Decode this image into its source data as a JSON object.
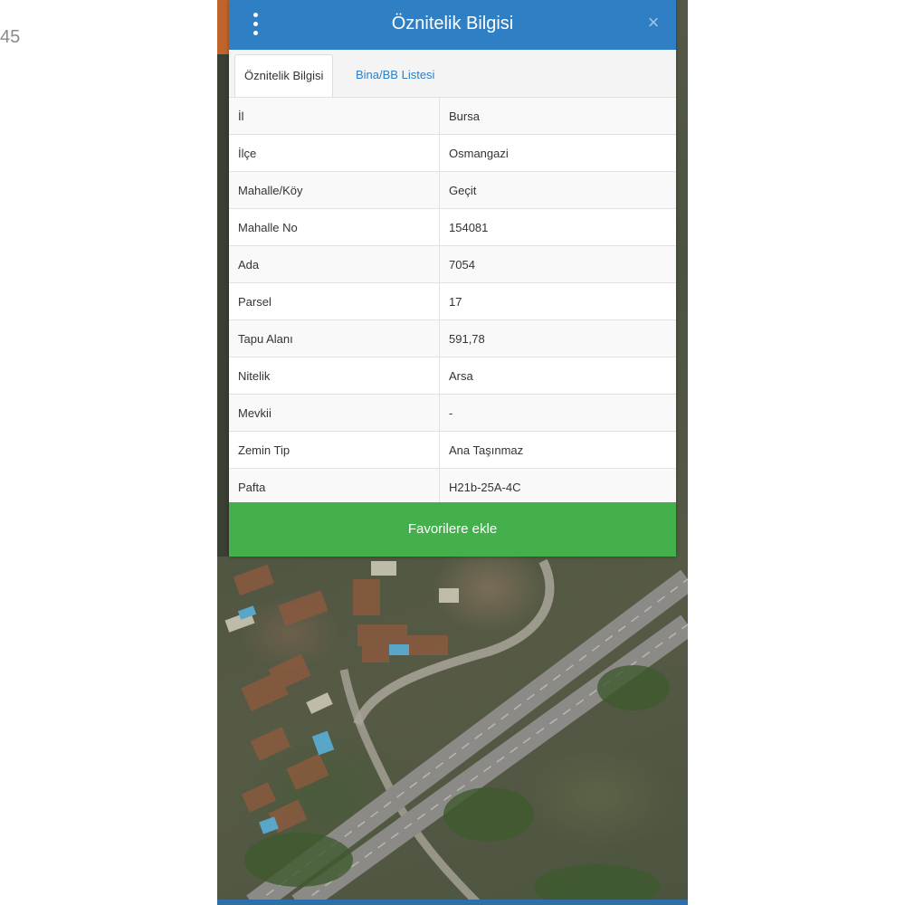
{
  "edge_text": "45",
  "panel": {
    "title": "Öznitelik Bilgisi",
    "menu_icon": "vertical-dots-icon",
    "close_icon": "close-icon",
    "close_glyph": "×"
  },
  "tabs": [
    {
      "label": "Öznitelik Bilgisi",
      "active": true
    },
    {
      "label": "Bina/BB Listesi",
      "active": false
    }
  ],
  "attributes": [
    {
      "key": "İl",
      "value": "Bursa"
    },
    {
      "key": "İlçe",
      "value": "Osmangazi"
    },
    {
      "key": "Mahalle/Köy",
      "value": "Geçit"
    },
    {
      "key": "Mahalle No",
      "value": "154081"
    },
    {
      "key": "Ada",
      "value": "7054"
    },
    {
      "key": "Parsel",
      "value": "17"
    },
    {
      "key": "Tapu Alanı",
      "value": "591,78"
    },
    {
      "key": "Nitelik",
      "value": "Arsa"
    },
    {
      "key": "Mevkii",
      "value": "-"
    },
    {
      "key": "Zemin Tip",
      "value": "Ana Taşınmaz"
    },
    {
      "key": "Pafta",
      "value": "H21b-25A-4C"
    }
  ],
  "favorite_button": "Favorilere ekle",
  "colors": {
    "header": "#2f7fc4",
    "button": "#43b04c",
    "tab_link": "#2f7fc4"
  }
}
